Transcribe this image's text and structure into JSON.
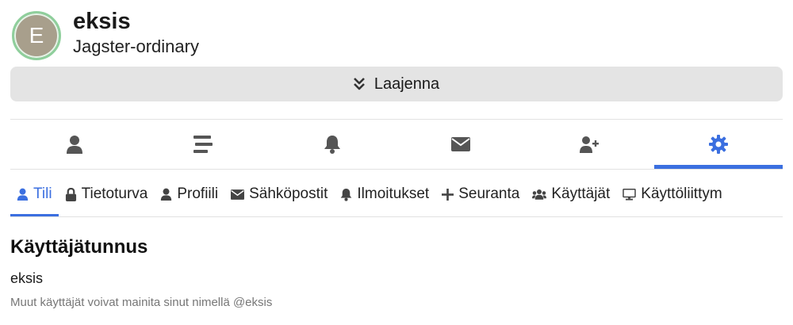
{
  "profile": {
    "avatar_letter": "E",
    "name": "eksis",
    "rank": "Jagster-ordinary"
  },
  "expand_button": {
    "label": "Laajenna",
    "icon": "chevrons-down-icon"
  },
  "icon_tabs": [
    {
      "icon": "user-icon",
      "active": false
    },
    {
      "icon": "list-icon",
      "active": false
    },
    {
      "icon": "bell-icon",
      "active": false
    },
    {
      "icon": "envelope-icon",
      "active": false
    },
    {
      "icon": "user-plus-icon",
      "active": false
    },
    {
      "icon": "gear-icon",
      "active": true
    }
  ],
  "sub_tabs": [
    {
      "label": "Tili",
      "icon": "user-icon",
      "active": true
    },
    {
      "label": "Tietoturva",
      "icon": "lock-icon",
      "active": false
    },
    {
      "label": "Profiili",
      "icon": "user-icon",
      "active": false
    },
    {
      "label": "Sähköpostit",
      "icon": "envelope-icon",
      "active": false
    },
    {
      "label": "Ilmoitukset",
      "icon": "bell-icon",
      "active": false
    },
    {
      "label": "Seuranta",
      "icon": "plus-icon",
      "active": false
    },
    {
      "label": "Käyttäjät",
      "icon": "users-icon",
      "active": false
    },
    {
      "label": "Käyttöliittym",
      "icon": "monitor-icon",
      "active": false
    }
  ],
  "account": {
    "section_title": "Käyttäjätunnus",
    "username": "eksis",
    "hint": "Muut käyttäjät voivat mainita sinut nimellä @eksis"
  },
  "colors": {
    "accent": "#3b6fe0",
    "icon_gray": "#555555",
    "expand_bg": "#e4e4e4"
  }
}
